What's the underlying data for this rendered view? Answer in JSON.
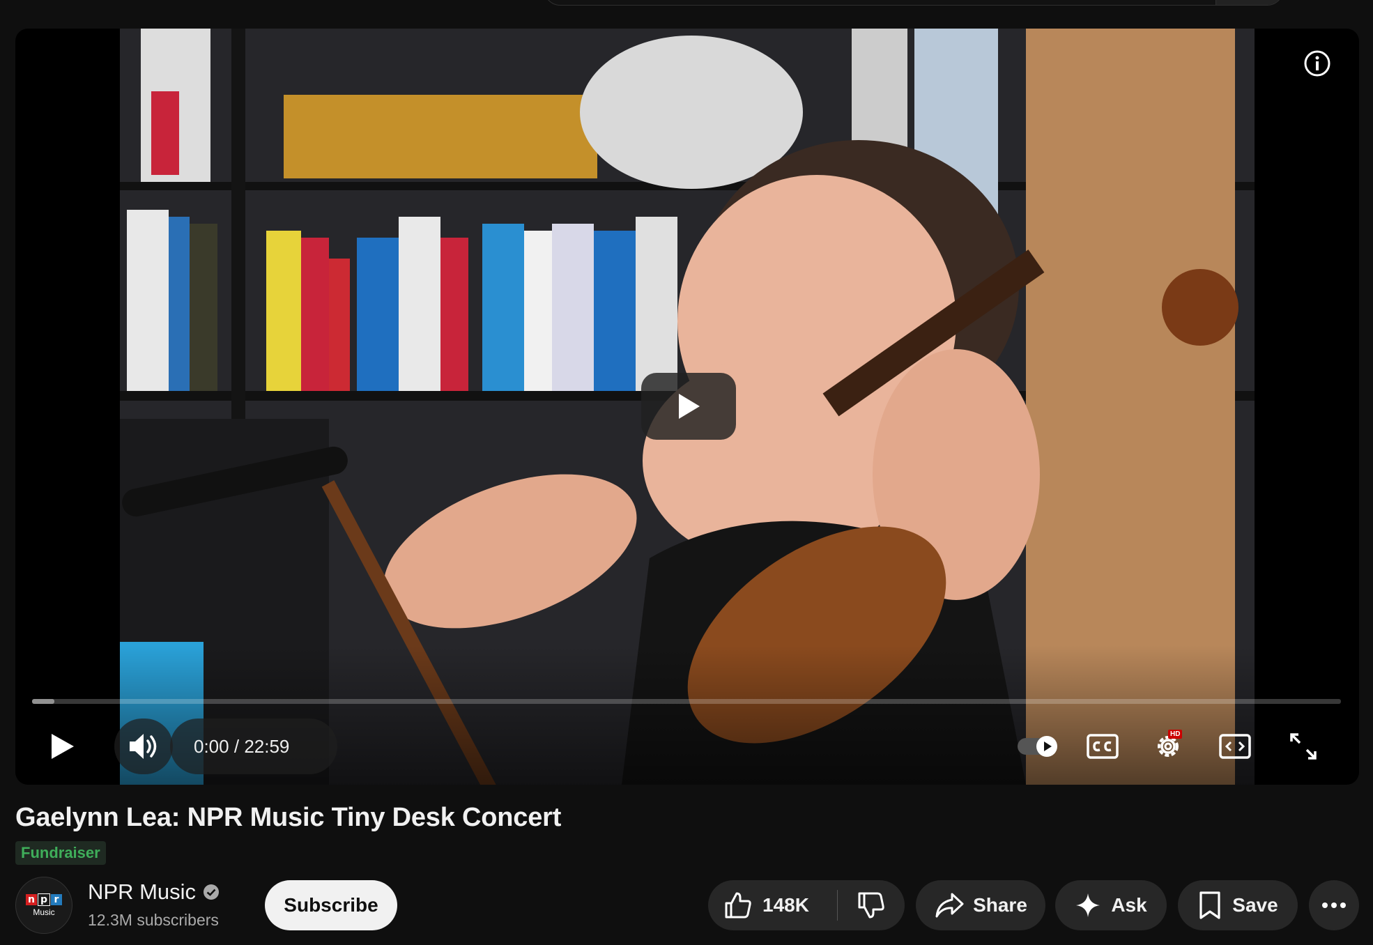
{
  "player": {
    "time_current": "0:00",
    "time_separator": "/",
    "time_total": "22:59",
    "progress_fraction": 0.017,
    "hd_label": "HD"
  },
  "video": {
    "title": "Gaelynn Lea: NPR Music Tiny Desk Concert",
    "badge": "Fundraiser"
  },
  "channel": {
    "logo_letters": [
      "n",
      "p",
      "r"
    ],
    "logo_colors": [
      "#d62021",
      "#1a1a1a",
      "#237bbd"
    ],
    "logo_sub": "Music",
    "name": "NPR Music",
    "subscribers": "12.3M subscribers",
    "subscribe_label": "Subscribe"
  },
  "actions": {
    "like_count": "148K",
    "share_label": "Share",
    "ask_label": "Ask",
    "save_label": "Save"
  }
}
